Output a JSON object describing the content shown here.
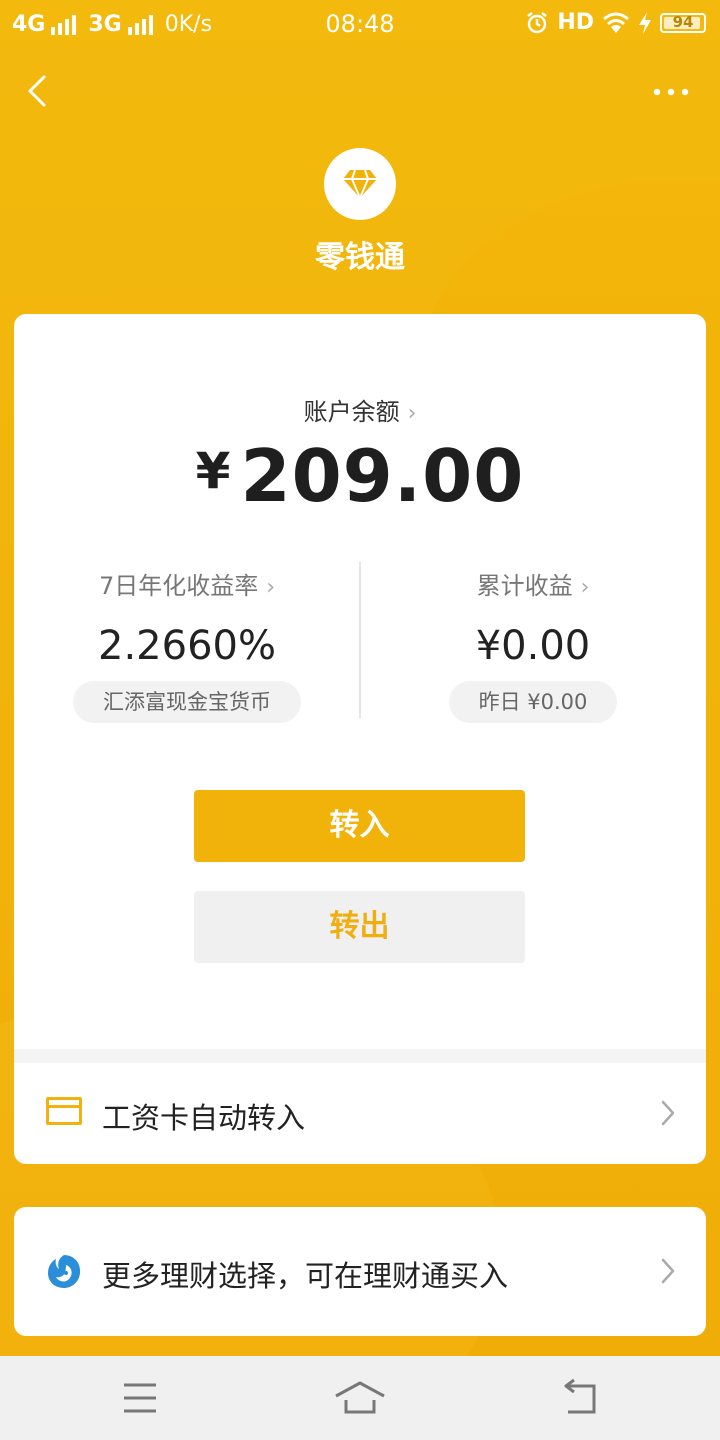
{
  "status_bar": {
    "net1": "4G",
    "net2": "3G",
    "speed": "0K/s",
    "time": "08:48",
    "hd": "HD",
    "battery": "94",
    "battery_level": 0.94
  },
  "header": {
    "title": "零钱通"
  },
  "balance": {
    "label": "账户余额",
    "currency": "¥",
    "amount": "209.00"
  },
  "stats": {
    "rate_label": "7日年化收益率",
    "rate_value": "2.2660%",
    "rate_pill": "汇添富现金宝货币",
    "earn_label": "累计收益",
    "earn_value": "¥0.00",
    "earn_pill": "昨日 ¥0.00"
  },
  "buttons": {
    "transfer_in": "转入",
    "transfer_out": "转出"
  },
  "rows": {
    "salary": "工资卡自动转入",
    "more_finance": "更多理财选择，可在理财通买入"
  },
  "colors": {
    "brand": "#f1b20a",
    "background": "#f2b60c",
    "card": "#ffffff"
  },
  "icons": [
    "back-icon",
    "more-icon",
    "diamond-icon",
    "chevron-right-icon",
    "card-icon",
    "fish-icon",
    "menu-icon",
    "home-icon",
    "return-icon"
  ]
}
